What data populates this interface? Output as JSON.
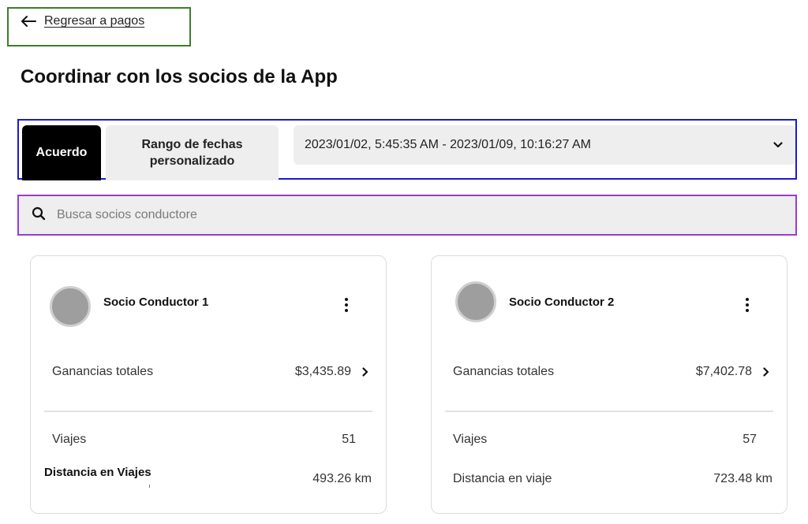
{
  "back": {
    "label": "Regresar a pagos"
  },
  "page": {
    "title": "Coordinar con los socios de la App"
  },
  "filters": {
    "tabs": [
      {
        "label": "Acuerdo",
        "selected": true
      },
      {
        "label": "Rango de fechas personalizado",
        "selected": false
      }
    ],
    "date_range": "2023/01/02, 5:45:35 AM - 2023/01/09, 10:16:27 AM"
  },
  "search": {
    "placeholder": "Busca socios conductores"
  },
  "drivers": [
    {
      "name": "Socio Conductor 1",
      "earnings_label": "Ganancias totales",
      "earnings": "$3,435.89",
      "trips_label": "Viajes",
      "trips": "51",
      "distance_label": "Distancia en Viajes",
      "distance": "493.26 km"
    },
    {
      "name": "Socio Conductor 2",
      "earnings_label": "Ganancias totales",
      "earnings": "$7,402.78",
      "trips_label": "Viajes",
      "trips": "57",
      "distance_label": "Distancia en viaje",
      "distance": "723.48 km"
    }
  ],
  "colors": {
    "back_outline": "#3d7d2a",
    "filter_outline": "#1a1ad0",
    "search_outline": "#9a3ad6",
    "selected_tab": "#000000",
    "surface": "#eeeeee"
  },
  "icons": {
    "back": "arrow-left-icon",
    "dropdown": "chevron-down-icon",
    "search": "search-icon",
    "menu": "more-vertical-icon",
    "detail": "chevron-right-icon"
  }
}
